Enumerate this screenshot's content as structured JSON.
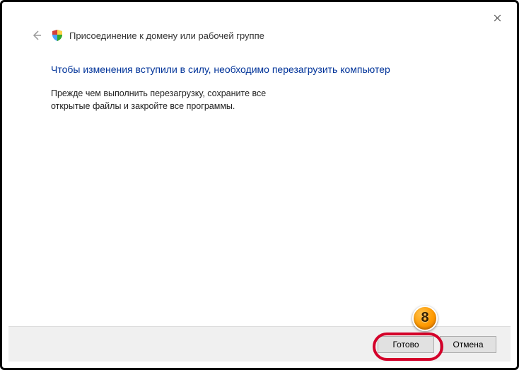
{
  "window": {
    "close_tooltip": "Закрыть"
  },
  "header": {
    "title": "Присоединение к домену или рабочей группе"
  },
  "content": {
    "heading": "Чтобы изменения вступили в силу, необходимо перезагрузить компьютер",
    "body_line1": "Прежде чем выполнить перезагрузку, сохраните все",
    "body_line2": "открытые файлы и закройте все программы."
  },
  "footer": {
    "finish_label": "Готово",
    "cancel_label": "Отмена"
  },
  "annotation": {
    "step_number": "8"
  }
}
